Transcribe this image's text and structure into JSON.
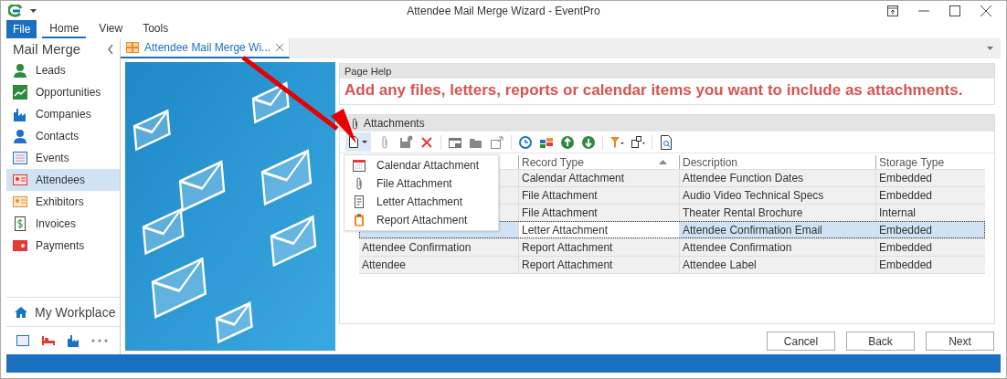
{
  "title_bar": {
    "title": "Attendee Mail Merge Wizard - EventPro"
  },
  "ribbon_tabs": [
    {
      "label": "File",
      "kind": "file",
      "selected": false
    },
    {
      "label": "Home",
      "kind": "tab",
      "selected": true
    },
    {
      "label": "View",
      "kind": "tab",
      "selected": false
    },
    {
      "label": "Tools",
      "kind": "tab",
      "selected": false
    }
  ],
  "sidebar": {
    "title": "Mail Merge",
    "items": [
      {
        "label": "Leads",
        "selected": false
      },
      {
        "label": "Opportunities",
        "selected": false
      },
      {
        "label": "Companies",
        "selected": false
      },
      {
        "label": "Contacts",
        "selected": false
      },
      {
        "label": "Events",
        "selected": false
      },
      {
        "label": "Attendees",
        "selected": true
      },
      {
        "label": "Exhibitors",
        "selected": false
      },
      {
        "label": "Invoices",
        "selected": false
      },
      {
        "label": "Payments",
        "selected": false
      }
    ],
    "footer": "My Workplace"
  },
  "document_tab": {
    "label": "Attendee Mail Merge Wi..."
  },
  "page_help": {
    "header": "Page Help",
    "text": "Add any files, letters, reports or calendar items you want to include as attachments."
  },
  "attachments": {
    "header": "Attachments",
    "new_menu": [
      "Calendar Attachment",
      "File Attachment",
      "Letter Attachment",
      "Report Attachment"
    ],
    "table": {
      "columns": [
        {
          "label": "Record Type",
          "sorted": true
        },
        {
          "label": "Description",
          "sorted": false
        },
        {
          "label": "Storage Type",
          "sorted": false
        }
      ],
      "rows": [
        {
          "record_type": "Calendar Attachment",
          "description": "Attendee Function Dates",
          "storage_type": "Embedded",
          "selected": false
        },
        {
          "record_type": "File Attachment",
          "description": "Audio Video Technical Specs",
          "storage_type": "Embedded",
          "selected": false
        },
        {
          "record_type": "File Attachment",
          "description": "Theater Rental Brochure",
          "storage_type": "Internal",
          "selected": false
        },
        {
          "record_type": "Letter Attachment",
          "description": "Attendee Confirmation Email",
          "storage_type": "Embedded",
          "selected": true
        },
        {
          "name": "Attendee Confirmation",
          "record_type": "Report Attachment",
          "description": "Attendee Confirmation",
          "storage_type": "Embedded",
          "selected": false
        },
        {
          "name": "Attendee",
          "record_type": "Report Attachment",
          "description": "Attendee Label",
          "storage_type": "Embedded",
          "selected": false
        }
      ]
    }
  },
  "buttons": [
    {
      "label": "Cancel"
    },
    {
      "label": "Back"
    },
    {
      "label": "Next"
    }
  ]
}
